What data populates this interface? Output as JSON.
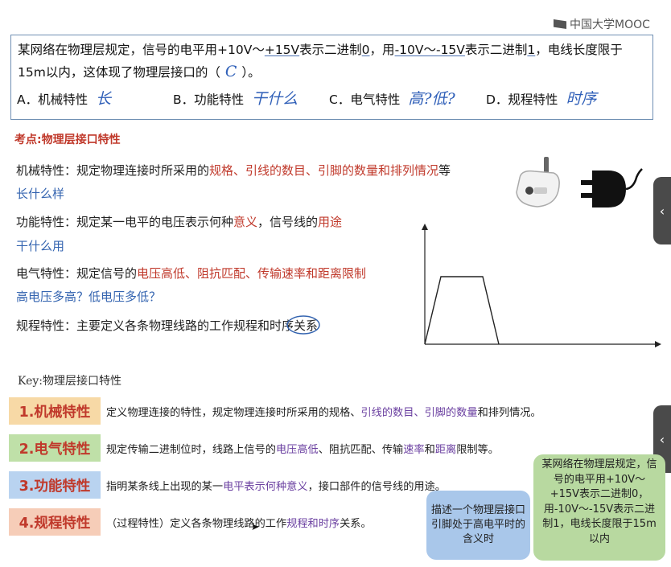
{
  "header": {
    "logo_text": "中国大学MOOC"
  },
  "question": {
    "line1_a": "某网络在物理层规定，信号的电平用+10V～",
    "line1_b": "+15V",
    "line1_c": "表示二进制",
    "line1_d": "0",
    "line1_e": "，用",
    "line1_f": "-10V～-15V",
    "line1_g": "表示二进制",
    "line1_h": "1",
    "line1_i": "，电线长度限于",
    "line2_a": "15m以内，这体现了物理层接口的（",
    "line2_answer": "C",
    "line2_b": "）。",
    "options": [
      {
        "label": "A．机械特性",
        "note": "长"
      },
      {
        "label": "B．功能特性",
        "note": "干什么"
      },
      {
        "label": "C．电气特性",
        "note": "高?低?"
      },
      {
        "label": "D．规程特性",
        "note": "时序"
      }
    ]
  },
  "topic": "考点:物理层接口特性",
  "definitions": {
    "mech_a": "机械特性：规定物理连接时所采用的",
    "mech_b": "规格、引线的数目、引脚的数量和排列情况",
    "mech_c": "等",
    "mech_sub": "长什么样",
    "func_a": "功能特性：规定某一电平的电压表示何种",
    "func_b": "意义",
    "func_c": "，信号线的",
    "func_d": "用途",
    "func_sub": "干什么用",
    "elec_a": "电气特性：规定信号的",
    "elec_b": "电压高低、阻抗匹配、传输速率和距离限制",
    "elec_sub": "高电压多高？低电压多低？",
    "proc": "规程特性：主要定义各条物理线路的工作规程和时序关系"
  },
  "key_title": "Key:物理层接口特性",
  "key_items": [
    {
      "badge": "1.机械特性",
      "d1": "定义物理连接的特性，规定物理连接时所采用的规格、",
      "d2": "引线的数目、引脚的数量",
      "d3": "和排列情况。",
      "bg": "#f7d9a6"
    },
    {
      "badge": "2.电气特性",
      "d1": "规定传输二进制位时，线路上信号的",
      "d2": "电压高低",
      "d3": "、阻抗匹配、传输",
      "d4": "速率",
      "d5": "和",
      "d6": "距离",
      "d7": "限制等。",
      "bg": "#bfe0a8"
    },
    {
      "badge": "3.功能特性",
      "d1": "指明某条线上出现的某一",
      "d2": "电平表示何种意义",
      "d3": "，接口部件的信号线的用途。",
      "bg": "#b9d3f0"
    },
    {
      "badge": "4.规程特性",
      "d1": "（过程特性）定义各条物理线路的工作",
      "d2": "规程和时序",
      "d3": "关系。",
      "bg": "#f6cdb8"
    }
  ],
  "bubbles": {
    "blue": "描述一个物理层接口引脚处于高电平时的含义时",
    "green": "某网络在物理层规定，信号的电平用+10V～+15V表示二进制0，用-10V～-15V表示二进制1，电线长度限于15m以内"
  },
  "icons": {
    "plug": "power-plug-icon",
    "gate": "and-gate-icon",
    "tab": "chevron-left-icon"
  },
  "colors": {
    "accent_red": "#c0392b",
    "accent_blue": "#3464b0",
    "box_border": "#6f8fb3"
  }
}
